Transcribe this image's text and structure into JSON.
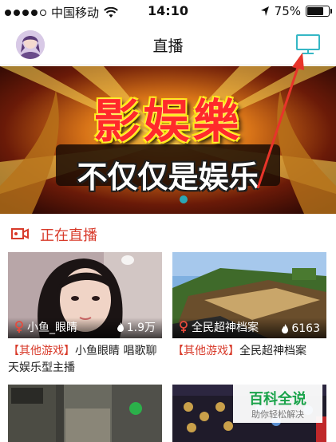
{
  "status_bar": {
    "carrier": "中国移动",
    "time": "14:10",
    "battery": "75%",
    "battery_level": 0.75
  },
  "nav": {
    "title": "直播",
    "avatar_icon": "user-avatar",
    "tv_icon": "tv-icon"
  },
  "banner": {
    "headline": "影娱樂",
    "slogan": "不仅仅是娱乐",
    "page_indicator_active": 1
  },
  "section": {
    "label": "正在直播",
    "icon": "video-camera-icon"
  },
  "streams": [
    {
      "anchor": "小鱼_眼睛",
      "views": "1.9万",
      "tag": "【其他游戏】",
      "title": "小鱼眼睛 唱歌聊天娱乐型主播"
    },
    {
      "anchor": "全民超神档案",
      "views": "6163",
      "tag": "【其他游戏】",
      "title": "全民超神档案"
    }
  ],
  "watermark": {
    "title": "百科全说",
    "subtitle": "助你轻松解决"
  },
  "colors": {
    "accent_red": "#d83a2a",
    "tv_cyan": "#35b7c5",
    "watermark_green": "#1aa34a"
  }
}
